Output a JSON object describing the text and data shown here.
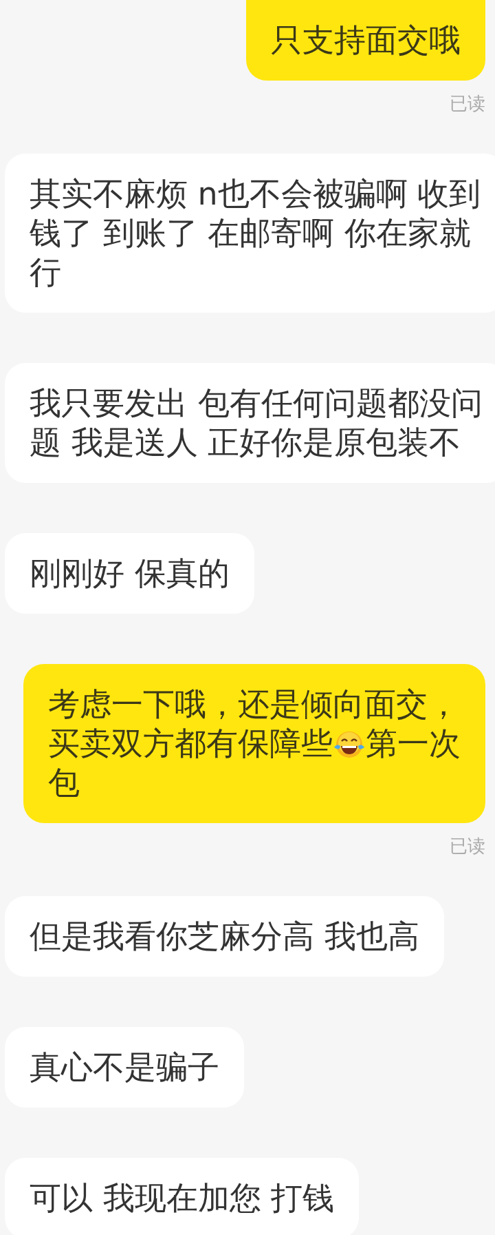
{
  "messages": [
    {
      "kind": "sent",
      "lines": [
        "只支持面交哦"
      ],
      "read_receipt": "已读"
    },
    {
      "kind": "received",
      "lines": [
        "其实不麻烦 n也不会被骗啊 收到",
        "钱了 到账了 在邮寄啊 你在家就",
        "行"
      ]
    },
    {
      "kind": "received",
      "lines": [
        "我只要发出 包有任何问题都没问",
        "题 我是送人 正好你是原包装不"
      ]
    },
    {
      "kind": "received",
      "lines": [
        "刚刚好 保真的"
      ]
    },
    {
      "kind": "sent",
      "lines": [
        "考虑一下哦，还是倾向面交，",
        [
          {
            "kind": "text",
            "text": "买卖双方都有保障些"
          },
          {
            "kind": "emoji"
          },
          {
            "kind": "text",
            "text": "第一次"
          }
        ],
        "包"
      ],
      "read_receipt": "已读"
    },
    {
      "kind": "received",
      "lines": [
        "但是我看你芝麻分高 我也高"
      ]
    },
    {
      "kind": "received",
      "lines": [
        "真心不是骗子"
      ]
    },
    {
      "kind": "received",
      "lines": [
        "可以 我现在加您 打钱"
      ]
    }
  ]
}
